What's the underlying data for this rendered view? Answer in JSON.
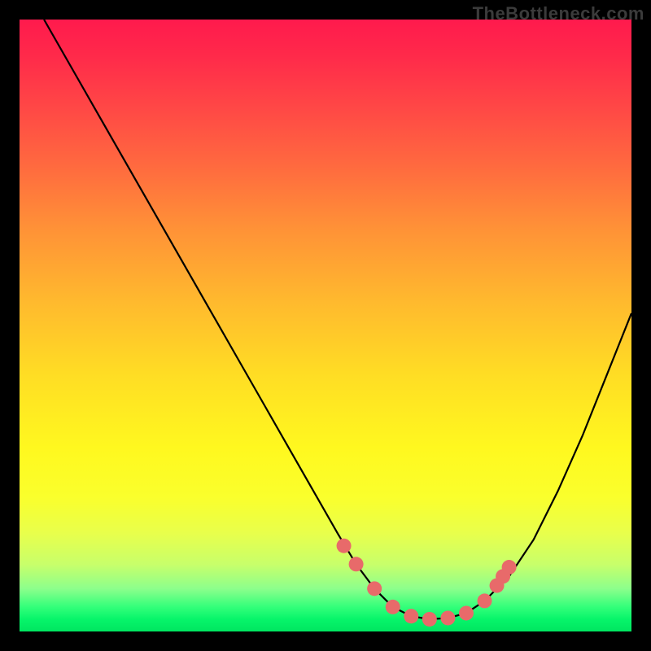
{
  "watermark": "TheBottleneck.com",
  "chart_data": {
    "type": "line",
    "title": "",
    "xlabel": "",
    "ylabel": "",
    "xlim": [
      0,
      100
    ],
    "ylim": [
      0,
      100
    ],
    "series": [
      {
        "name": "curve",
        "x": [
          4,
          8,
          12,
          16,
          20,
          24,
          28,
          32,
          36,
          40,
          44,
          48,
          52,
          55,
          58,
          61,
          64,
          67,
          70,
          73,
          76,
          80,
          84,
          88,
          92,
          96,
          100
        ],
        "y": [
          100,
          93,
          86,
          79,
          72,
          65,
          58,
          51,
          44,
          37,
          30,
          23,
          16,
          11,
          7,
          4,
          2.5,
          2,
          2.2,
          3,
          5,
          9,
          15,
          23,
          32,
          42,
          52
        ]
      },
      {
        "name": "markers",
        "x": [
          53,
          55,
          58,
          61,
          64,
          67,
          70,
          73,
          76,
          78,
          79,
          80
        ],
        "y": [
          14,
          11,
          7,
          4,
          2.5,
          2,
          2.2,
          3,
          5,
          7.5,
          9,
          10.5
        ]
      }
    ],
    "background_gradient": {
      "top": "#ff1a4d",
      "mid": "#ffe626",
      "bottom": "#00e660"
    },
    "curve_color": "#000000",
    "marker_color": "#e86a6a"
  }
}
